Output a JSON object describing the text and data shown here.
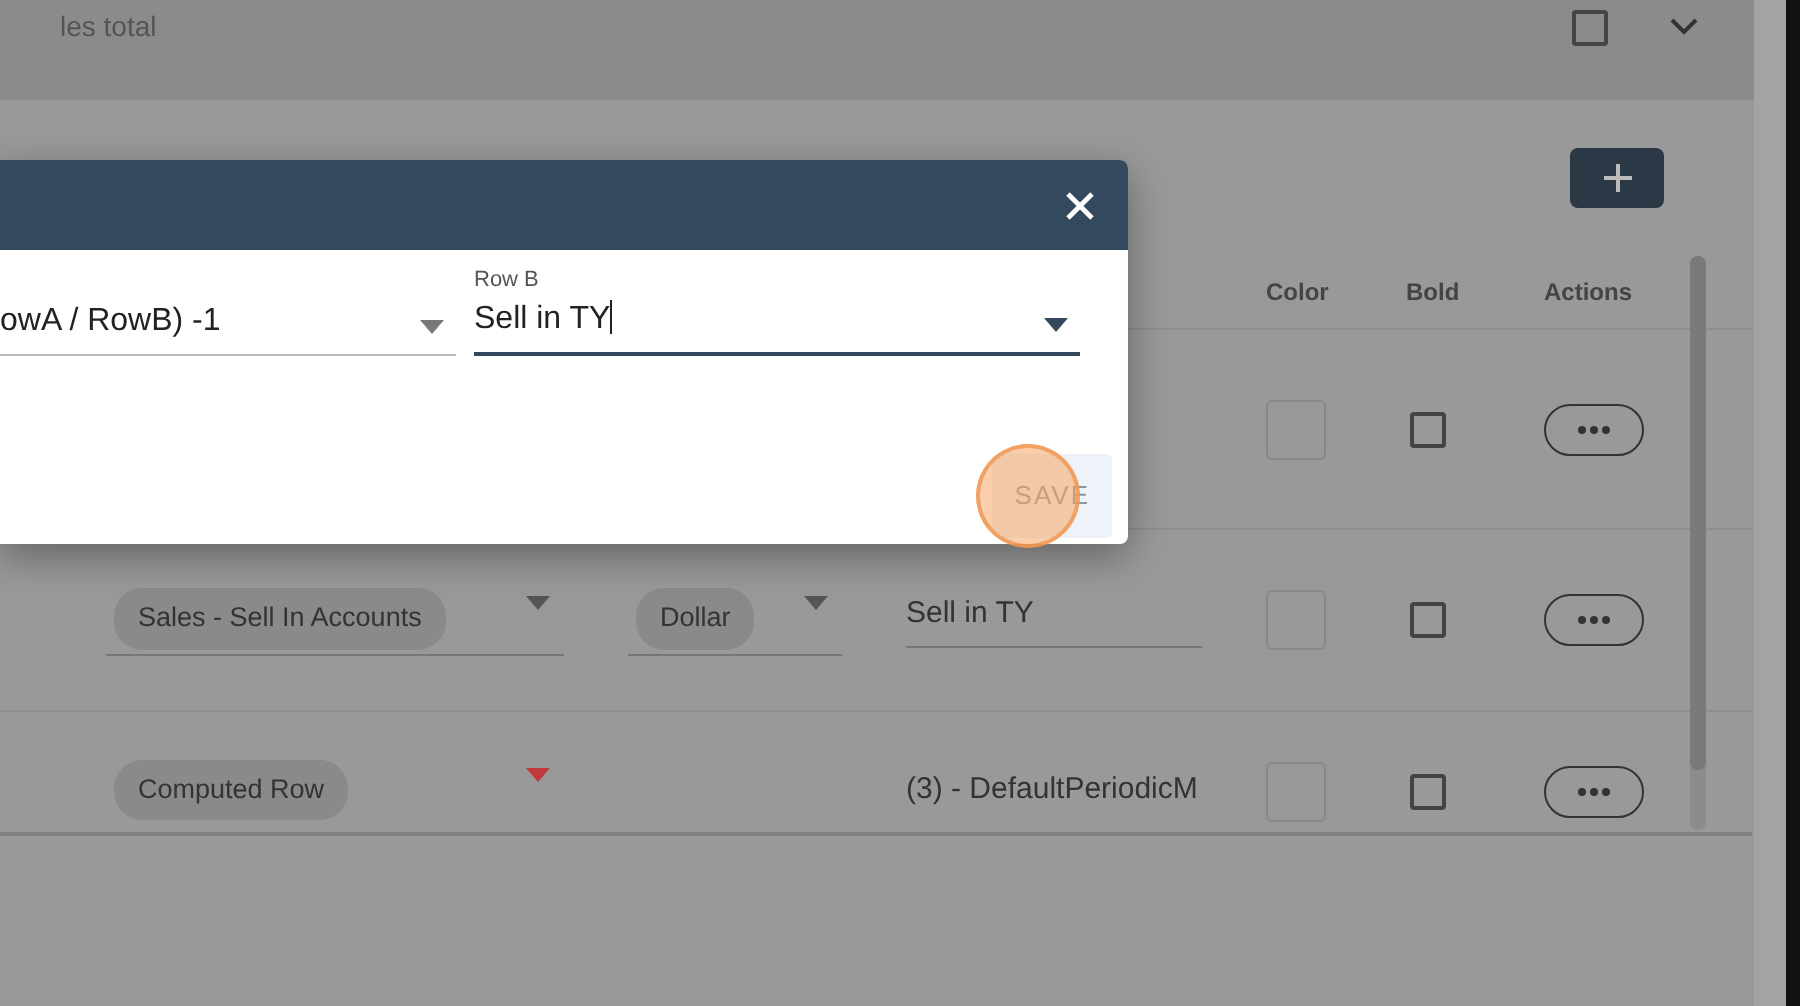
{
  "header": {
    "title": "les total",
    "checked": false
  },
  "table": {
    "columns": [
      "Color",
      "Bold",
      "Actions"
    ],
    "rows": [
      {
        "bold": false
      },
      {
        "source": "Sales - Sell In Accounts",
        "source_error": false,
        "unit": "Dollar",
        "name": "Sell in TY",
        "bold": false
      },
      {
        "source": "Computed Row",
        "source_error": true,
        "name": "(3) - DefaultPeriodicM",
        "bold": false
      }
    ]
  },
  "dialog": {
    "fields": [
      {
        "value": "owA / RowB) -1",
        "focused": false
      },
      {
        "label": "Row B",
        "value": "Sell in TY",
        "focused": true
      }
    ],
    "save_button": "SAVE"
  }
}
